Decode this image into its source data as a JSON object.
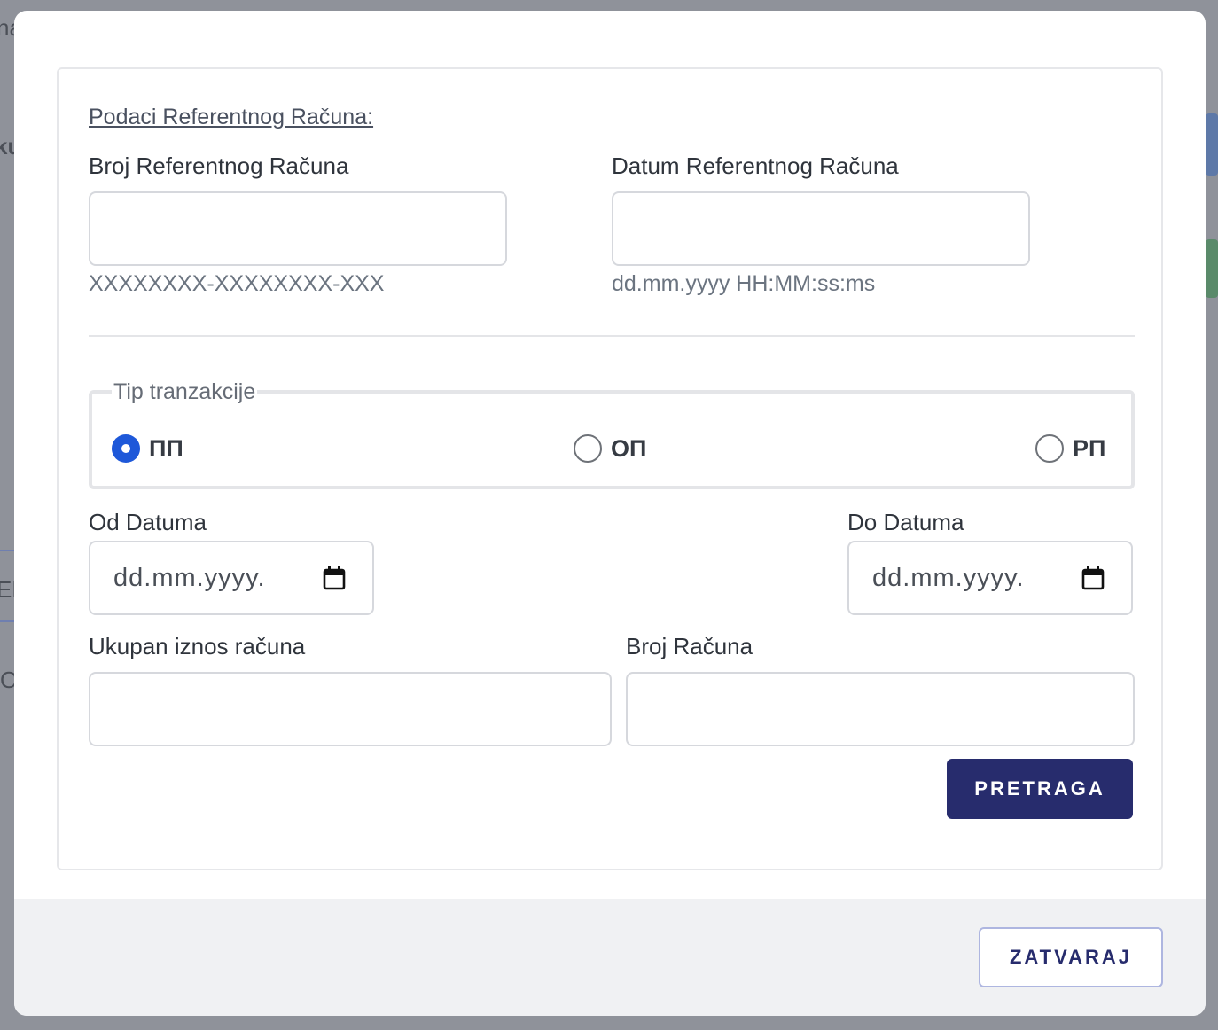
{
  "background": {
    "fragments": [
      "na",
      "ku",
      "ER",
      "O"
    ]
  },
  "reference": {
    "section_title": "Podaci Referentnog Računa:",
    "number_label": "Broj Referentnog Računa",
    "number_value": "",
    "number_hint": "XXXXXXXX-XXXXXXXX-XXX",
    "date_label": "Datum Referentnog Računa",
    "date_value": "",
    "date_hint": "dd.mm.yyyy HH:MM:ss:ms"
  },
  "transaction_type": {
    "legend": "Tip tranzakcije",
    "options": [
      {
        "label": "ПП",
        "checked": true
      },
      {
        "label": "ОП",
        "checked": false
      },
      {
        "label": "РП",
        "checked": false
      }
    ]
  },
  "dates": {
    "from_label": "Od Datuma",
    "from_placeholder": "dd.mm.yyyy.",
    "to_label": "Do Datuma",
    "to_placeholder": "dd.mm.yyyy."
  },
  "amount": {
    "label": "Ukupan iznos računa",
    "value": ""
  },
  "account": {
    "label": "Broj Računa",
    "value": ""
  },
  "actions": {
    "search_label": "PRETRAGA",
    "close_label": "ZATVARAJ"
  },
  "colors": {
    "primary": "#272c6d",
    "radio_checked": "#1e58d9",
    "footer_bg": "#f0f1f3"
  }
}
